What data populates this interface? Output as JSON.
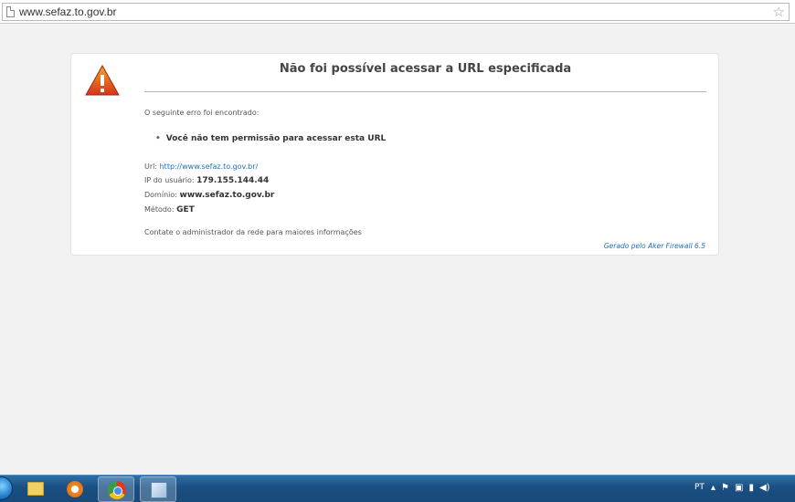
{
  "browser": {
    "url": "www.sefaz.to.gov.br"
  },
  "error": {
    "title": "Não foi possível acessar a URL especificada",
    "intro": "O seguinte erro foi encontrado:",
    "items": [
      "Você não tem permissão para acessar esta URL"
    ],
    "details": {
      "url_label": "Url:",
      "url_value": "http://www.sefaz.to.gov.br/",
      "ip_label": "IP do usuário:",
      "ip_value": "179.155.144.44",
      "domain_label": "Domínio:",
      "domain_value": "www.sefaz.to.gov.br",
      "method_label": "Método:",
      "method_value": "GET"
    },
    "contact": "Contate o administrador da rede para maiores informações",
    "footer": "Gerado pelo Aker Firewall 6.5"
  },
  "taskbar": {
    "language": "PT",
    "tray_icons": [
      "arrow-up-icon",
      "flag-icon",
      "network-icon",
      "signal-icon",
      "speaker-icon"
    ]
  },
  "icons": {
    "address": "page-icon",
    "bookmark": "star-icon",
    "warning": "warning-icon"
  },
  "colors": {
    "link": "#1f6fb5",
    "taskbar": "#1b4e80",
    "warning": "#d94a1e"
  }
}
